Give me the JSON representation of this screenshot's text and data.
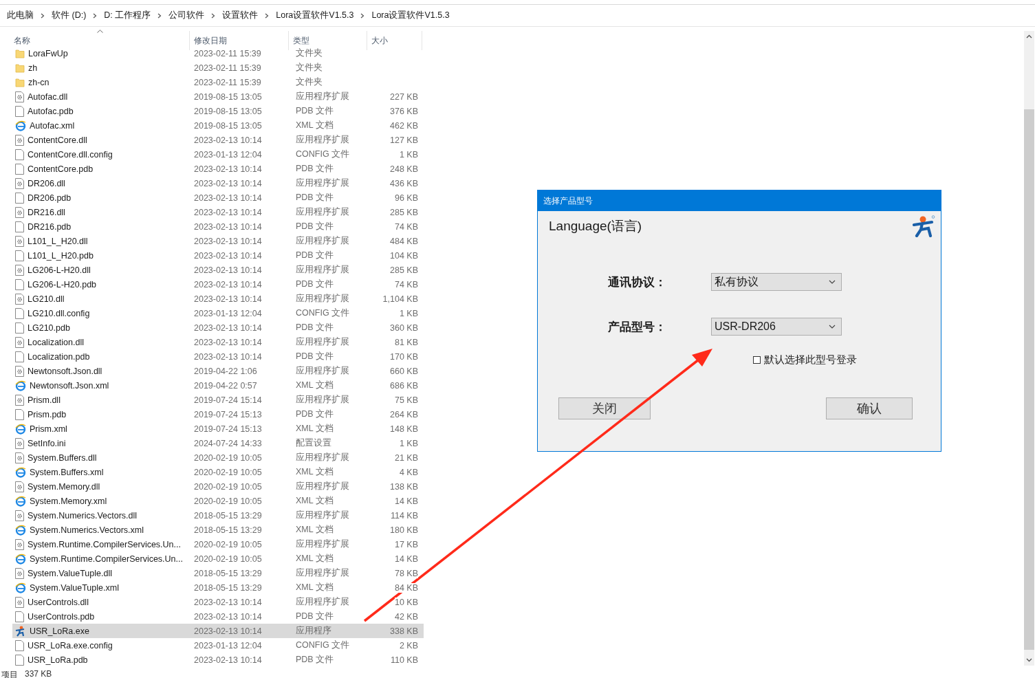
{
  "breadcrumb": [
    "此电脑",
    "软件 (D:)",
    "D:  工作程序",
    "公司软件",
    "设置软件",
    "Lora设置软件V1.5.3",
    "Lora设置软件V1.5.3"
  ],
  "table": {
    "columns": [
      "名称",
      "修改日期",
      "类型",
      "大小"
    ],
    "rows": [
      {
        "name": "LoraFwUp",
        "date": "2023-02-11 15:39",
        "type": "文件夹",
        "size": "",
        "kind": "folder",
        "selected": false
      },
      {
        "name": "zh",
        "date": "2023-02-11 15:39",
        "type": "文件夹",
        "size": "",
        "kind": "folder",
        "selected": false
      },
      {
        "name": "zh-cn",
        "date": "2023-02-11 15:39",
        "type": "文件夹",
        "size": "",
        "kind": "folder",
        "selected": false
      },
      {
        "name": "Autofac.dll",
        "date": "2019-08-15 13:05",
        "type": "应用程序扩展",
        "size": "227 KB",
        "kind": "dll",
        "selected": false
      },
      {
        "name": "Autofac.pdb",
        "date": "2019-08-15 13:05",
        "type": "PDB 文件",
        "size": "376 KB",
        "kind": "file",
        "selected": false
      },
      {
        "name": "Autofac.xml",
        "date": "2019-08-15 13:05",
        "type": "XML 文档",
        "size": "462 KB",
        "kind": "xml",
        "selected": false
      },
      {
        "name": "ContentCore.dll",
        "date": "2023-02-13 10:14",
        "type": "应用程序扩展",
        "size": "127 KB",
        "kind": "dll",
        "selected": false
      },
      {
        "name": "ContentCore.dll.config",
        "date": "2023-01-13 12:04",
        "type": "CONFIG 文件",
        "size": "1 KB",
        "kind": "file",
        "selected": false
      },
      {
        "name": "ContentCore.pdb",
        "date": "2023-02-13 10:14",
        "type": "PDB 文件",
        "size": "248 KB",
        "kind": "file",
        "selected": false
      },
      {
        "name": "DR206.dll",
        "date": "2023-02-13 10:14",
        "type": "应用程序扩展",
        "size": "436 KB",
        "kind": "dll",
        "selected": false
      },
      {
        "name": "DR206.pdb",
        "date": "2023-02-13 10:14",
        "type": "PDB 文件",
        "size": "96 KB",
        "kind": "file",
        "selected": false
      },
      {
        "name": "DR216.dll",
        "date": "2023-02-13 10:14",
        "type": "应用程序扩展",
        "size": "285 KB",
        "kind": "dll",
        "selected": false
      },
      {
        "name": "DR216.pdb",
        "date": "2023-02-13 10:14",
        "type": "PDB 文件",
        "size": "74 KB",
        "kind": "file",
        "selected": false
      },
      {
        "name": "L101_L_H20.dll",
        "date": "2023-02-13 10:14",
        "type": "应用程序扩展",
        "size": "484 KB",
        "kind": "dll",
        "selected": false
      },
      {
        "name": "L101_L_H20.pdb",
        "date": "2023-02-13 10:14",
        "type": "PDB 文件",
        "size": "104 KB",
        "kind": "file",
        "selected": false
      },
      {
        "name": "LG206-L-H20.dll",
        "date": "2023-02-13 10:14",
        "type": "应用程序扩展",
        "size": "285 KB",
        "kind": "dll",
        "selected": false
      },
      {
        "name": "LG206-L-H20.pdb",
        "date": "2023-02-13 10:14",
        "type": "PDB 文件",
        "size": "74 KB",
        "kind": "file",
        "selected": false
      },
      {
        "name": "LG210.dll",
        "date": "2023-02-13 10:14",
        "type": "应用程序扩展",
        "size": "1,104 KB",
        "kind": "dll",
        "selected": false
      },
      {
        "name": "LG210.dll.config",
        "date": "2023-01-13 12:04",
        "type": "CONFIG 文件",
        "size": "1 KB",
        "kind": "file",
        "selected": false
      },
      {
        "name": "LG210.pdb",
        "date": "2023-02-13 10:14",
        "type": "PDB 文件",
        "size": "360 KB",
        "kind": "file",
        "selected": false
      },
      {
        "name": "Localization.dll",
        "date": "2023-02-13 10:14",
        "type": "应用程序扩展",
        "size": "81 KB",
        "kind": "dll",
        "selected": false
      },
      {
        "name": "Localization.pdb",
        "date": "2023-02-13 10:14",
        "type": "PDB 文件",
        "size": "170 KB",
        "kind": "file",
        "selected": false
      },
      {
        "name": "Newtonsoft.Json.dll",
        "date": "2019-04-22 1:06",
        "type": "应用程序扩展",
        "size": "660 KB",
        "kind": "dll",
        "selected": false
      },
      {
        "name": "Newtonsoft.Json.xml",
        "date": "2019-04-22 0:57",
        "type": "XML 文档",
        "size": "686 KB",
        "kind": "xml",
        "selected": false
      },
      {
        "name": "Prism.dll",
        "date": "2019-07-24 15:14",
        "type": "应用程序扩展",
        "size": "75 KB",
        "kind": "dll",
        "selected": false
      },
      {
        "name": "Prism.pdb",
        "date": "2019-07-24 15:13",
        "type": "PDB 文件",
        "size": "264 KB",
        "kind": "file",
        "selected": false
      },
      {
        "name": "Prism.xml",
        "date": "2019-07-24 15:13",
        "type": "XML 文档",
        "size": "148 KB",
        "kind": "xml",
        "selected": false
      },
      {
        "name": "SetInfo.ini",
        "date": "2024-07-24 14:33",
        "type": "配置设置",
        "size": "1 KB",
        "kind": "dll",
        "selected": false
      },
      {
        "name": "System.Buffers.dll",
        "date": "2020-02-19 10:05",
        "type": "应用程序扩展",
        "size": "21 KB",
        "kind": "dll",
        "selected": false
      },
      {
        "name": "System.Buffers.xml",
        "date": "2020-02-19 10:05",
        "type": "XML 文档",
        "size": "4 KB",
        "kind": "xml",
        "selected": false
      },
      {
        "name": "System.Memory.dll",
        "date": "2020-02-19 10:05",
        "type": "应用程序扩展",
        "size": "138 KB",
        "kind": "dll",
        "selected": false
      },
      {
        "name": "System.Memory.xml",
        "date": "2020-02-19 10:05",
        "type": "XML 文档",
        "size": "14 KB",
        "kind": "xml",
        "selected": false
      },
      {
        "name": "System.Numerics.Vectors.dll",
        "date": "2018-05-15 13:29",
        "type": "应用程序扩展",
        "size": "114 KB",
        "kind": "dll",
        "selected": false
      },
      {
        "name": "System.Numerics.Vectors.xml",
        "date": "2018-05-15 13:29",
        "type": "XML 文档",
        "size": "180 KB",
        "kind": "xml",
        "selected": false
      },
      {
        "name": "System.Runtime.CompilerServices.Un...",
        "date": "2020-02-19 10:05",
        "type": "应用程序扩展",
        "size": "17 KB",
        "kind": "dll",
        "selected": false
      },
      {
        "name": "System.Runtime.CompilerServices.Un...",
        "date": "2020-02-19 10:05",
        "type": "XML 文档",
        "size": "14 KB",
        "kind": "xml",
        "selected": false
      },
      {
        "name": "System.ValueTuple.dll",
        "date": "2018-05-15 13:29",
        "type": "应用程序扩展",
        "size": "78 KB",
        "kind": "dll",
        "selected": false
      },
      {
        "name": "System.ValueTuple.xml",
        "date": "2018-05-15 13:29",
        "type": "XML 文档",
        "size": "84 KB",
        "kind": "xml",
        "selected": false
      },
      {
        "name": "UserControls.dll",
        "date": "2023-02-13 10:14",
        "type": "应用程序扩展",
        "size": "10 KB",
        "kind": "dll",
        "selected": false
      },
      {
        "name": "UserControls.pdb",
        "date": "2023-02-13 10:14",
        "type": "PDB 文件",
        "size": "42 KB",
        "kind": "file",
        "selected": false
      },
      {
        "name": "USR_LoRa.exe",
        "date": "2023-02-13 10:14",
        "type": "应用程序",
        "size": "338 KB",
        "kind": "exe",
        "selected": true
      },
      {
        "name": "USR_LoRa.exe.config",
        "date": "2023-01-13 12:04",
        "type": "CONFIG 文件",
        "size": "2 KB",
        "kind": "file",
        "selected": false
      },
      {
        "name": "USR_LoRa.pdb",
        "date": "2023-02-13 10:14",
        "type": "PDB 文件",
        "size": "110 KB",
        "kind": "file",
        "selected": false
      }
    ]
  },
  "status_bar": {
    "items_label": "项目",
    "size": "337 KB"
  },
  "dialog": {
    "title": "选择产品型号",
    "heading": "Language(语言)",
    "fields": [
      {
        "label": "通讯协议：",
        "value": "私有协议"
      },
      {
        "label": "产品型号：",
        "value": "USR-DR206"
      }
    ],
    "checkbox": {
      "label": "默认选择此型号登录",
      "checked": false
    },
    "buttons": [
      "关闭",
      "确认"
    ]
  }
}
